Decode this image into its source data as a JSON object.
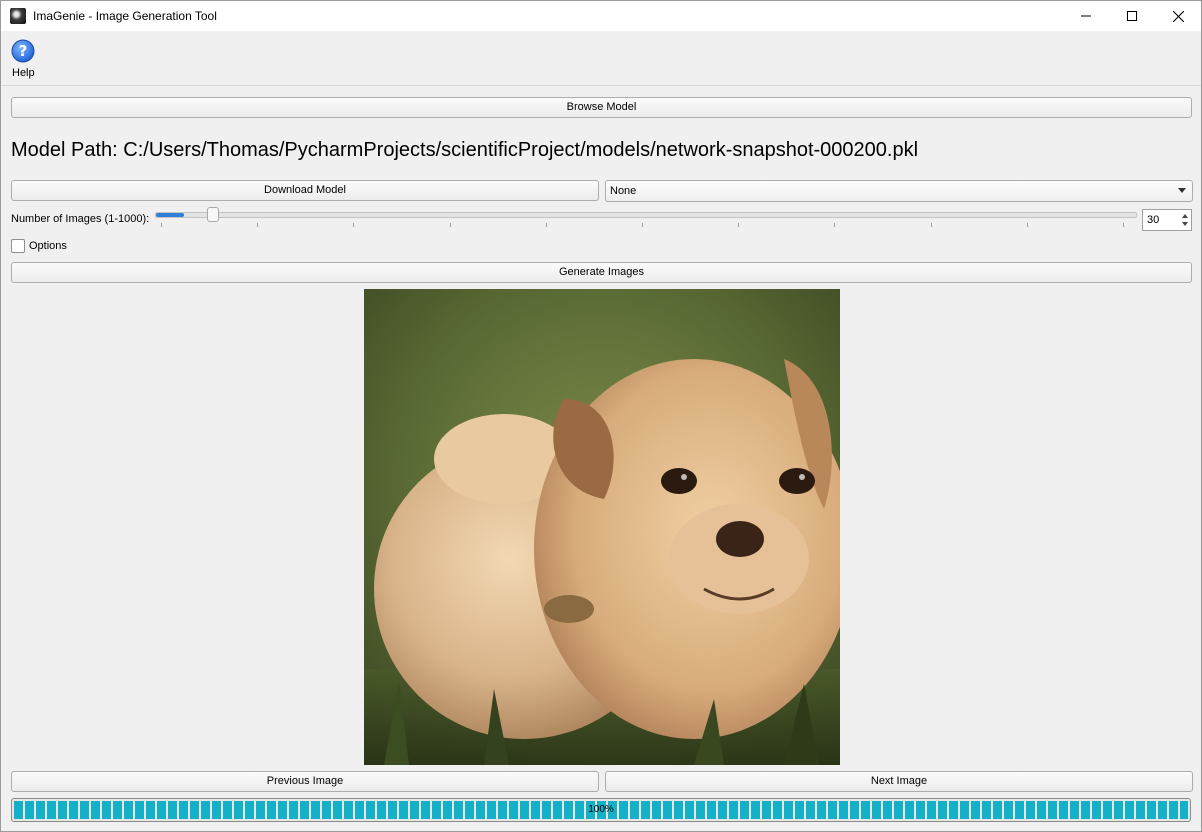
{
  "window": {
    "title": "ImaGenie - Image Generation Tool",
    "icon": "app-icon",
    "controls": [
      "minimize-icon",
      "maximize-icon",
      "close-icon"
    ]
  },
  "toolbar": {
    "help_label": "Help",
    "help_icon": "help-icon"
  },
  "browse_button_label": "Browse Model",
  "model_path_text": "Model Path: C:/Users/Thomas/PycharmProjects/scientificProject/models/network-snapshot-000200.pkl",
  "download_button_label": "Download Model",
  "model_select": {
    "selected": "None"
  },
  "image_count": {
    "label": "Number of Images (1-1000):",
    "min": 1,
    "max": 1000,
    "value": "30"
  },
  "options": {
    "label": "Options",
    "checked": false
  },
  "generate_button_label": "Generate Images",
  "image_view": {
    "subject": "generated-puppy-image"
  },
  "nav": {
    "previous_label": "Previous Image",
    "next_label": "Next Image"
  },
  "progress": {
    "value": 1.0,
    "text": "100%"
  },
  "colors": {
    "accent": "#2e7fd7",
    "progress": "#14b0c8",
    "window_bg": "#f0f0f0"
  }
}
